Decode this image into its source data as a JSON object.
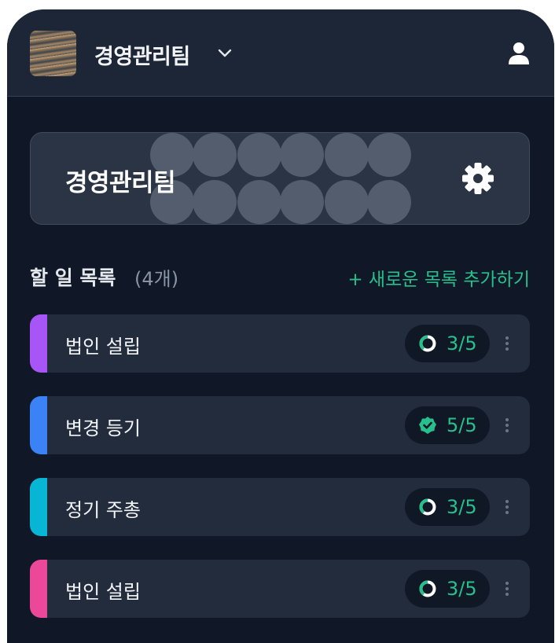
{
  "header": {
    "team_name": "경영관리팀",
    "avatar_icon": "team-photo",
    "dropdown_icon": "chevron-down-icon",
    "profile_icon": "user-icon"
  },
  "hero": {
    "title": "경영관리팀",
    "settings_icon": "gear-icon"
  },
  "todo_section": {
    "title": "할 일 목록",
    "count": "(4개)",
    "add_label": "+ 새로운 목록 추가하기"
  },
  "todo_lists": [
    {
      "label": "법인 설립",
      "progress": "3/5",
      "done": 3,
      "total": 5,
      "color": "#a855f7",
      "status_icon": "progress-ring-icon"
    },
    {
      "label": "변경 등기",
      "progress": "5/5",
      "done": 5,
      "total": 5,
      "color": "#3b82f6",
      "status_icon": "check-badge-icon"
    },
    {
      "label": "정기 주총",
      "progress": "3/5",
      "done": 3,
      "total": 5,
      "color": "#06b6d4",
      "status_icon": "progress-ring-icon"
    },
    {
      "label": "법인 설립",
      "progress": "3/5",
      "done": 3,
      "total": 5,
      "color": "#ec4899",
      "status_icon": "progress-ring-icon"
    }
  ],
  "colors": {
    "background": "#101828",
    "header": "#1d2636",
    "accent_green": "#27c08c"
  }
}
